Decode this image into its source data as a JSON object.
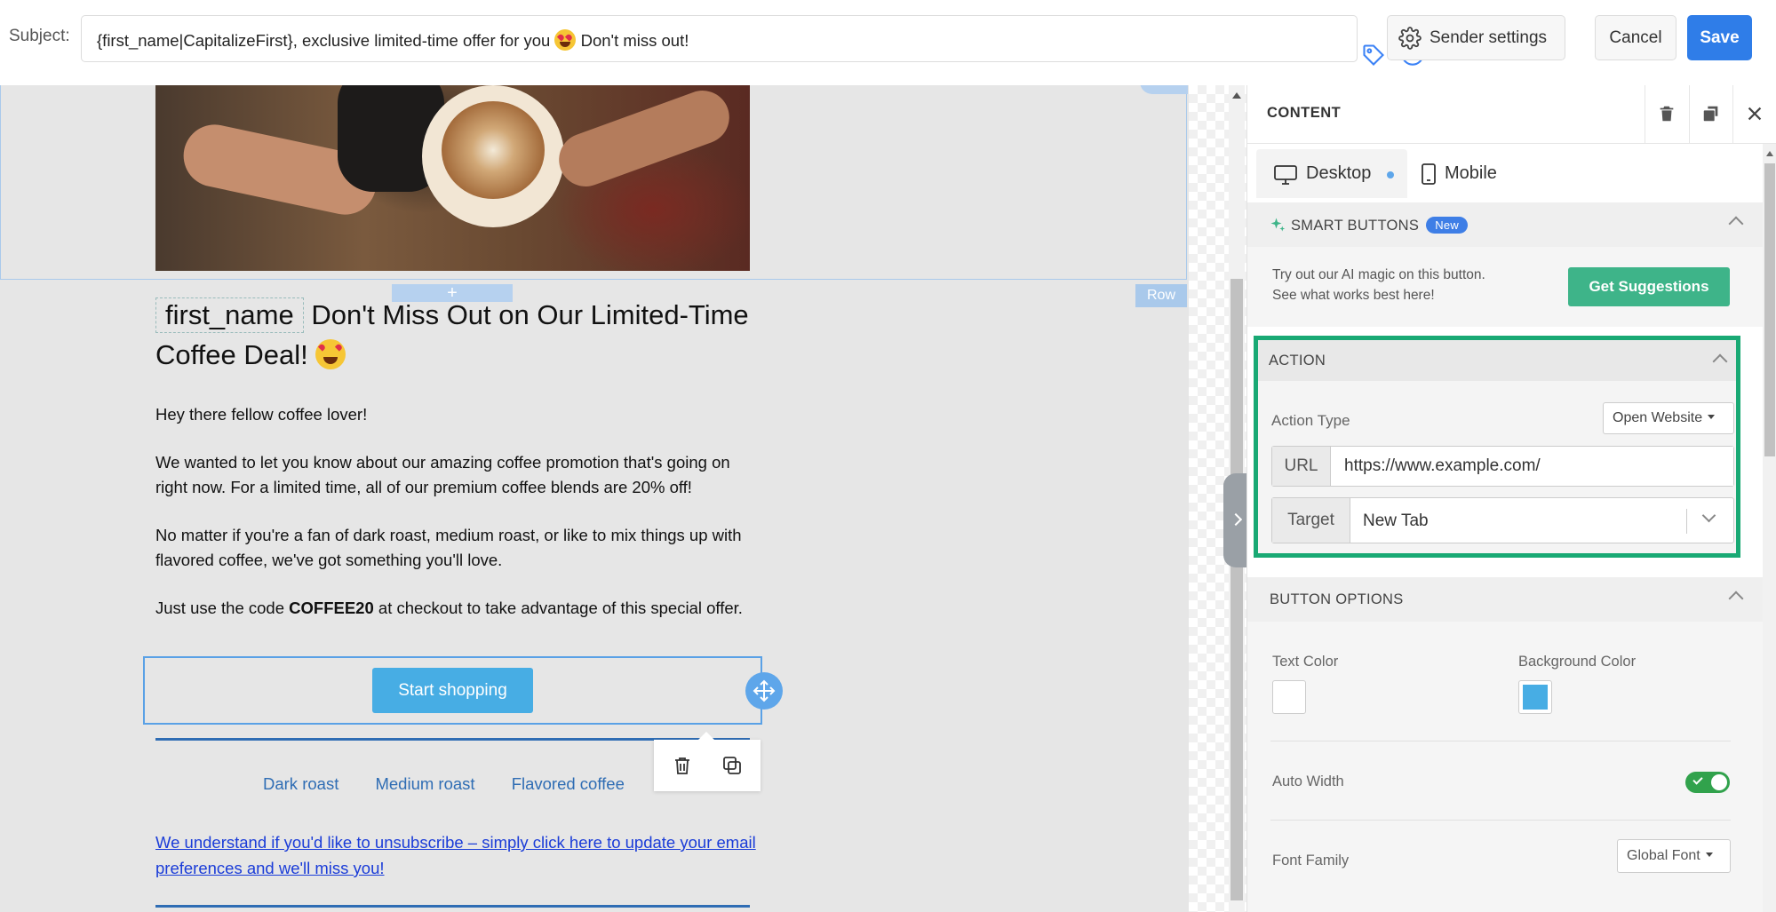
{
  "topbar": {
    "subject_label": "Subject:",
    "subject_before_emoji": "{first_name|CapitalizeFirst}, exclusive limited-time offer for you",
    "subject_after_emoji": "Don't miss out!",
    "sender_settings_label": "Sender settings",
    "cancel_label": "Cancel",
    "save_label": "Save"
  },
  "canvas": {
    "row_label": "Row",
    "row_plus": "+",
    "headline_merge_tag": "first_name",
    "headline_text_1": "Don't Miss Out on Our Limited-Time",
    "headline_text_2": "Coffee Deal!",
    "greeting": "Hey there fellow coffee lover!",
    "para_1": "We wanted to let you know about our amazing coffee promotion that's going on right now. For a limited time, all of our premium coffee blends are 20% off!",
    "para_2": "No matter if you're a fan of dark roast, medium roast, or like to mix things up with flavored coffee, we've got something you'll love.",
    "para_3_before": "Just use the code",
    "para_3_code": "COFFEE20",
    "para_3_after": "at checkout to take advantage of this special offer.",
    "cta_label": "Start shopping",
    "nav_links": [
      "Dark roast",
      "Medium roast",
      "Flavored coffee"
    ],
    "unsubscribe": "We understand if you'd like to unsubscribe – simply click here to update your email preferences and we'll miss you!"
  },
  "panel": {
    "title": "CONTENT",
    "tab_desktop": "Desktop",
    "tab_mobile": "Mobile",
    "smart_buttons": {
      "title": "SMART BUTTONS",
      "badge": "New",
      "line_1": "Try out our AI magic on this button.",
      "line_2": "See what works best here!",
      "button": "Get Suggestions"
    },
    "action": {
      "title": "ACTION",
      "action_type_label": "Action Type",
      "action_type_value": "Open Website",
      "url_label": "URL",
      "url_value": "https://www.example.com/",
      "target_label": "Target",
      "target_value": "New Tab"
    },
    "button_options": {
      "title": "BUTTON OPTIONS",
      "text_color_label": "Text Color",
      "text_color": "#ffffff",
      "background_color_label": "Background Color",
      "background_color": "#47ade4",
      "auto_width_label": "Auto Width",
      "auto_width": true,
      "font_family_label": "Font Family",
      "font_family_value": "Global Font"
    }
  },
  "colors": {
    "save_blue": "#2f7de8",
    "cta_blue": "#47ade4",
    "suggest_green": "#3eb489",
    "action_outline": "#19a974",
    "toggle_green": "#31a24c"
  }
}
